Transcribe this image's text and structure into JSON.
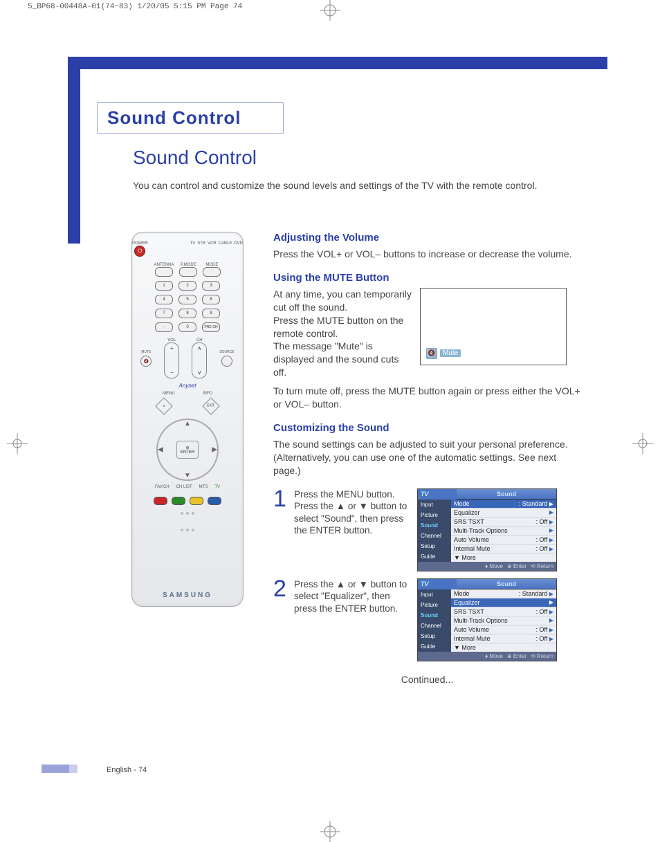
{
  "header_strip": "5_BP68-00448A-01(74~83)  1/20/05  5:15 PM  Page 74",
  "title_box": "Sound Control",
  "section_title": "Sound Control",
  "intro": "You can control and customize the sound levels and settings of the TV with the remote control.",
  "remote": {
    "power_label": "POWER",
    "top_labels": [
      "TV",
      "STB",
      "VCR",
      "CABLE",
      "DVD"
    ],
    "row1_labels": [
      "ANTENNA",
      "P.MODE",
      "MODE"
    ],
    "numpad": [
      [
        "1",
        "2",
        "3"
      ],
      [
        "4",
        "5",
        "6"
      ],
      [
        "7",
        "8",
        "9"
      ],
      [
        "-",
        "0",
        "PRE-CH"
      ]
    ],
    "vol_label": "VOL",
    "ch_label": "CH",
    "mute_label": "MUTE",
    "source_label": "SOURCE",
    "menu_label": "MENU",
    "info_label": "INFO",
    "exit_label": "EXIT",
    "enter_label": "ENTER",
    "favch_label": "FAV.CH",
    "chlist_label": "CH LIST",
    "mts_label": "MTS",
    "brand": "SAMSUNG",
    "anynet": "Anynet"
  },
  "sections": {
    "adjust": {
      "heading": "Adjusting the Volume",
      "body": "Press the VOL+ or VOL– buttons to increase or decrease the volume."
    },
    "mute": {
      "heading": "Using the MUTE Button",
      "body1": "At any time, you can temporarily cut off the sound.\nPress the MUTE button on the remote control.\nThe message \"Mute\" is displayed and the sound cuts off.",
      "body2": "To turn mute off, press the MUTE button again or press either the VOL+ or VOL– button.",
      "indicator": "Mute"
    },
    "customize": {
      "heading": "Customizing the Sound",
      "body": "The sound settings can be adjusted to suit your personal preference. (Alternatively, you can use one of the automatic settings. See next page.)",
      "steps": [
        {
          "num": "1",
          "text": "Press the MENU button. Press the ▲ or ▼ button to select \"Sound\", then press the ENTER button."
        },
        {
          "num": "2",
          "text": "Press the ▲ or ▼ button to select \"Equalizer\", then press the ENTER button."
        }
      ],
      "continued": "Continued..."
    }
  },
  "osd": {
    "tv_label": "TV",
    "title": "Sound",
    "menu_items": [
      "Input",
      "Picture",
      "Sound",
      "Channel",
      "Setup",
      "Guide"
    ],
    "rows": [
      {
        "label": "Mode",
        "value": ": Standard"
      },
      {
        "label": "Equalizer",
        "value": ""
      },
      {
        "label": "SRS TSXT",
        "value": ": Off"
      },
      {
        "label": "Multi-Track Options",
        "value": ""
      },
      {
        "label": "Auto Volume",
        "value": ": Off"
      },
      {
        "label": "Internal Mute",
        "value": ": Off"
      },
      {
        "label": "▼ More",
        "value": ""
      }
    ],
    "footer": {
      "move": "Move",
      "enter": "Enter",
      "return": "Return"
    }
  },
  "page_num": "English - 74"
}
